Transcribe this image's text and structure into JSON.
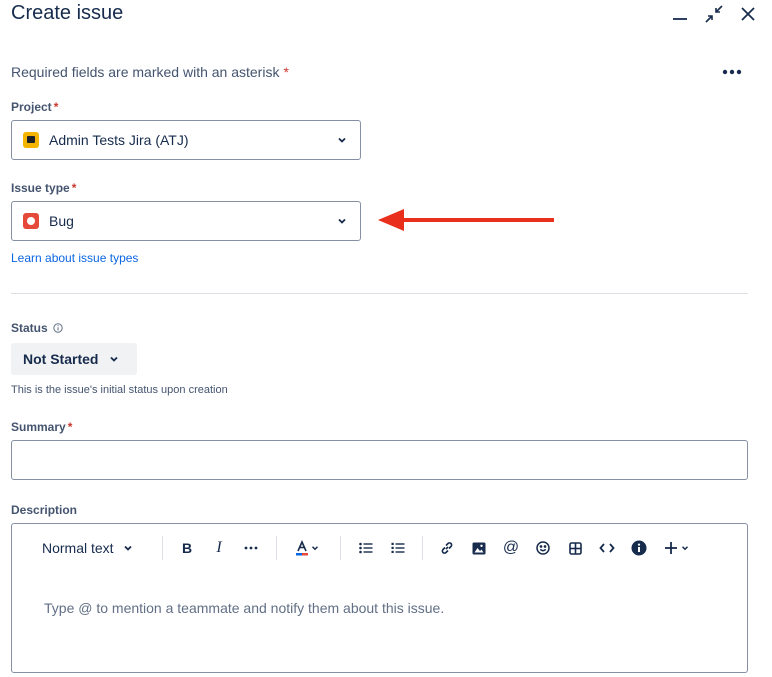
{
  "dialog": {
    "title": "Create issue",
    "required_note": "Required fields are marked with an asterisk",
    "required_star": "*"
  },
  "project": {
    "label": "Project",
    "value": "Admin Tests Jira (ATJ)"
  },
  "issue_type": {
    "label": "Issue type",
    "value": "Bug",
    "learn_link": "Learn about issue types"
  },
  "status": {
    "label": "Status",
    "value": "Not Started",
    "helper": "This is the issue's initial status upon creation"
  },
  "summary": {
    "label": "Summary",
    "value": ""
  },
  "description": {
    "label": "Description",
    "text_style": "Normal text",
    "placeholder": "Type @ to mention a teammate and notify them about this issue.",
    "bold": "B",
    "italic": "I",
    "mention": "@"
  },
  "colors": {
    "required": "#c9372c",
    "link": "#0c66e4",
    "annotation_arrow": "#e8301c",
    "bug": "#e5493a",
    "project_icon": "#f5b400",
    "text_color_underline": "#0c66e4"
  },
  "icons": [
    "minimize-icon",
    "collapse-icon",
    "close-icon",
    "more-icon",
    "chevron-down-icon",
    "info-icon",
    "bullet-list-icon",
    "numbered-list-icon",
    "link-icon",
    "image-icon",
    "emoji-icon",
    "table-icon",
    "code-icon",
    "info-panel-icon",
    "plus-icon"
  ]
}
